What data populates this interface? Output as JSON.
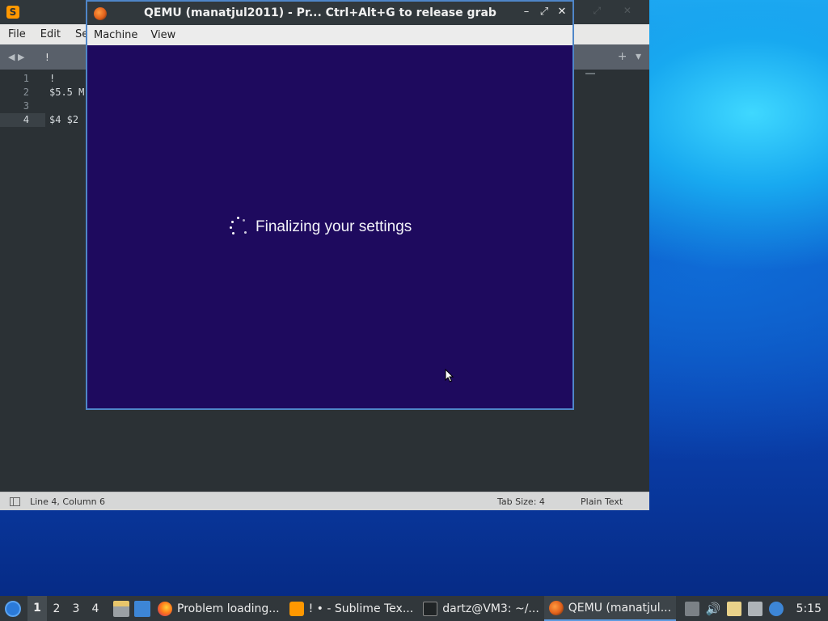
{
  "sublime": {
    "menu": [
      "File",
      "Edit",
      "Se"
    ],
    "tab_title": "!",
    "lines": [
      {
        "num": "1",
        "text": "!"
      },
      {
        "num": "2",
        "text": "$5.5 M"
      },
      {
        "num": "3",
        "text": ""
      },
      {
        "num": "4",
        "text": "$4 $2"
      }
    ],
    "status": {
      "position": "Line 4, Column 6",
      "tab_size": "Tab Size: 4",
      "syntax": "Plain Text"
    }
  },
  "qemu": {
    "title": "QEMU (manatjul2011) - Pr...  Ctrl+Alt+G to release grab",
    "menu": [
      "Machine",
      "View"
    ],
    "screen_message": "Finalizing your settings"
  },
  "taskbar": {
    "workspaces": [
      "1",
      "2",
      "3",
      "4"
    ],
    "tasks": [
      {
        "label": "Problem loading...",
        "icon": "firefox-icon"
      },
      {
        "label": "! • - Sublime Tex...",
        "icon": "sublime-icon"
      },
      {
        "label": "dartz@VM3: ~/...",
        "icon": "terminal-icon"
      },
      {
        "label": "QEMU (manatjul...",
        "icon": "qemu-icon"
      }
    ],
    "clock": "5:15"
  },
  "colors": {
    "qemu_screen": "#1e0a5e",
    "sublime_bg": "#2b3135",
    "taskbar": "#31373b"
  }
}
